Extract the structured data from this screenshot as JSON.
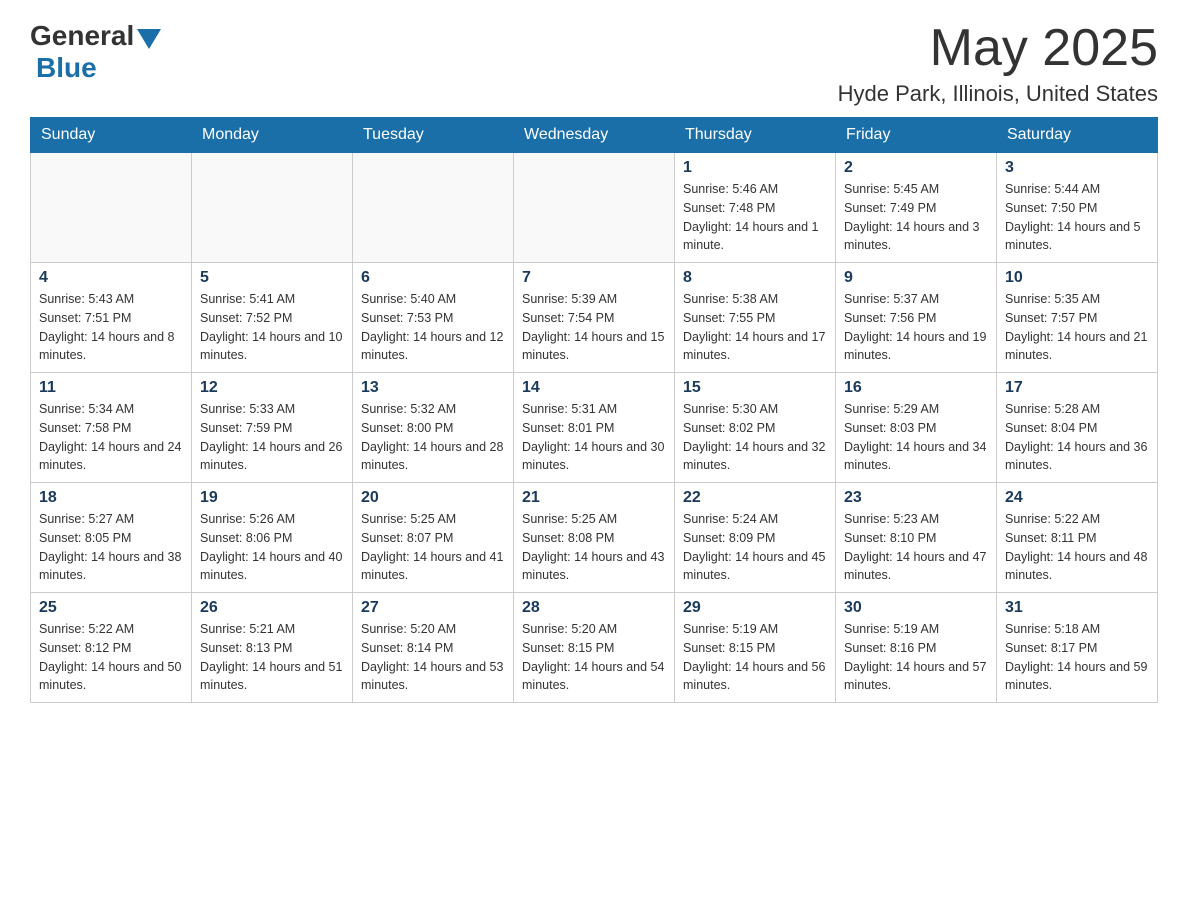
{
  "logo": {
    "general": "General",
    "blue": "Blue"
  },
  "title": {
    "month_year": "May 2025",
    "location": "Hyde Park, Illinois, United States"
  },
  "days_of_week": [
    "Sunday",
    "Monday",
    "Tuesday",
    "Wednesday",
    "Thursday",
    "Friday",
    "Saturday"
  ],
  "weeks": [
    [
      {
        "day": "",
        "info": ""
      },
      {
        "day": "",
        "info": ""
      },
      {
        "day": "",
        "info": ""
      },
      {
        "day": "",
        "info": ""
      },
      {
        "day": "1",
        "info": "Sunrise: 5:46 AM\nSunset: 7:48 PM\nDaylight: 14 hours and 1 minute."
      },
      {
        "day": "2",
        "info": "Sunrise: 5:45 AM\nSunset: 7:49 PM\nDaylight: 14 hours and 3 minutes."
      },
      {
        "day": "3",
        "info": "Sunrise: 5:44 AM\nSunset: 7:50 PM\nDaylight: 14 hours and 5 minutes."
      }
    ],
    [
      {
        "day": "4",
        "info": "Sunrise: 5:43 AM\nSunset: 7:51 PM\nDaylight: 14 hours and 8 minutes."
      },
      {
        "day": "5",
        "info": "Sunrise: 5:41 AM\nSunset: 7:52 PM\nDaylight: 14 hours and 10 minutes."
      },
      {
        "day": "6",
        "info": "Sunrise: 5:40 AM\nSunset: 7:53 PM\nDaylight: 14 hours and 12 minutes."
      },
      {
        "day": "7",
        "info": "Sunrise: 5:39 AM\nSunset: 7:54 PM\nDaylight: 14 hours and 15 minutes."
      },
      {
        "day": "8",
        "info": "Sunrise: 5:38 AM\nSunset: 7:55 PM\nDaylight: 14 hours and 17 minutes."
      },
      {
        "day": "9",
        "info": "Sunrise: 5:37 AM\nSunset: 7:56 PM\nDaylight: 14 hours and 19 minutes."
      },
      {
        "day": "10",
        "info": "Sunrise: 5:35 AM\nSunset: 7:57 PM\nDaylight: 14 hours and 21 minutes."
      }
    ],
    [
      {
        "day": "11",
        "info": "Sunrise: 5:34 AM\nSunset: 7:58 PM\nDaylight: 14 hours and 24 minutes."
      },
      {
        "day": "12",
        "info": "Sunrise: 5:33 AM\nSunset: 7:59 PM\nDaylight: 14 hours and 26 minutes."
      },
      {
        "day": "13",
        "info": "Sunrise: 5:32 AM\nSunset: 8:00 PM\nDaylight: 14 hours and 28 minutes."
      },
      {
        "day": "14",
        "info": "Sunrise: 5:31 AM\nSunset: 8:01 PM\nDaylight: 14 hours and 30 minutes."
      },
      {
        "day": "15",
        "info": "Sunrise: 5:30 AM\nSunset: 8:02 PM\nDaylight: 14 hours and 32 minutes."
      },
      {
        "day": "16",
        "info": "Sunrise: 5:29 AM\nSunset: 8:03 PM\nDaylight: 14 hours and 34 minutes."
      },
      {
        "day": "17",
        "info": "Sunrise: 5:28 AM\nSunset: 8:04 PM\nDaylight: 14 hours and 36 minutes."
      }
    ],
    [
      {
        "day": "18",
        "info": "Sunrise: 5:27 AM\nSunset: 8:05 PM\nDaylight: 14 hours and 38 minutes."
      },
      {
        "day": "19",
        "info": "Sunrise: 5:26 AM\nSunset: 8:06 PM\nDaylight: 14 hours and 40 minutes."
      },
      {
        "day": "20",
        "info": "Sunrise: 5:25 AM\nSunset: 8:07 PM\nDaylight: 14 hours and 41 minutes."
      },
      {
        "day": "21",
        "info": "Sunrise: 5:25 AM\nSunset: 8:08 PM\nDaylight: 14 hours and 43 minutes."
      },
      {
        "day": "22",
        "info": "Sunrise: 5:24 AM\nSunset: 8:09 PM\nDaylight: 14 hours and 45 minutes."
      },
      {
        "day": "23",
        "info": "Sunrise: 5:23 AM\nSunset: 8:10 PM\nDaylight: 14 hours and 47 minutes."
      },
      {
        "day": "24",
        "info": "Sunrise: 5:22 AM\nSunset: 8:11 PM\nDaylight: 14 hours and 48 minutes."
      }
    ],
    [
      {
        "day": "25",
        "info": "Sunrise: 5:22 AM\nSunset: 8:12 PM\nDaylight: 14 hours and 50 minutes."
      },
      {
        "day": "26",
        "info": "Sunrise: 5:21 AM\nSunset: 8:13 PM\nDaylight: 14 hours and 51 minutes."
      },
      {
        "day": "27",
        "info": "Sunrise: 5:20 AM\nSunset: 8:14 PM\nDaylight: 14 hours and 53 minutes."
      },
      {
        "day": "28",
        "info": "Sunrise: 5:20 AM\nSunset: 8:15 PM\nDaylight: 14 hours and 54 minutes."
      },
      {
        "day": "29",
        "info": "Sunrise: 5:19 AM\nSunset: 8:15 PM\nDaylight: 14 hours and 56 minutes."
      },
      {
        "day": "30",
        "info": "Sunrise: 5:19 AM\nSunset: 8:16 PM\nDaylight: 14 hours and 57 minutes."
      },
      {
        "day": "31",
        "info": "Sunrise: 5:18 AM\nSunset: 8:17 PM\nDaylight: 14 hours and 59 minutes."
      }
    ]
  ]
}
